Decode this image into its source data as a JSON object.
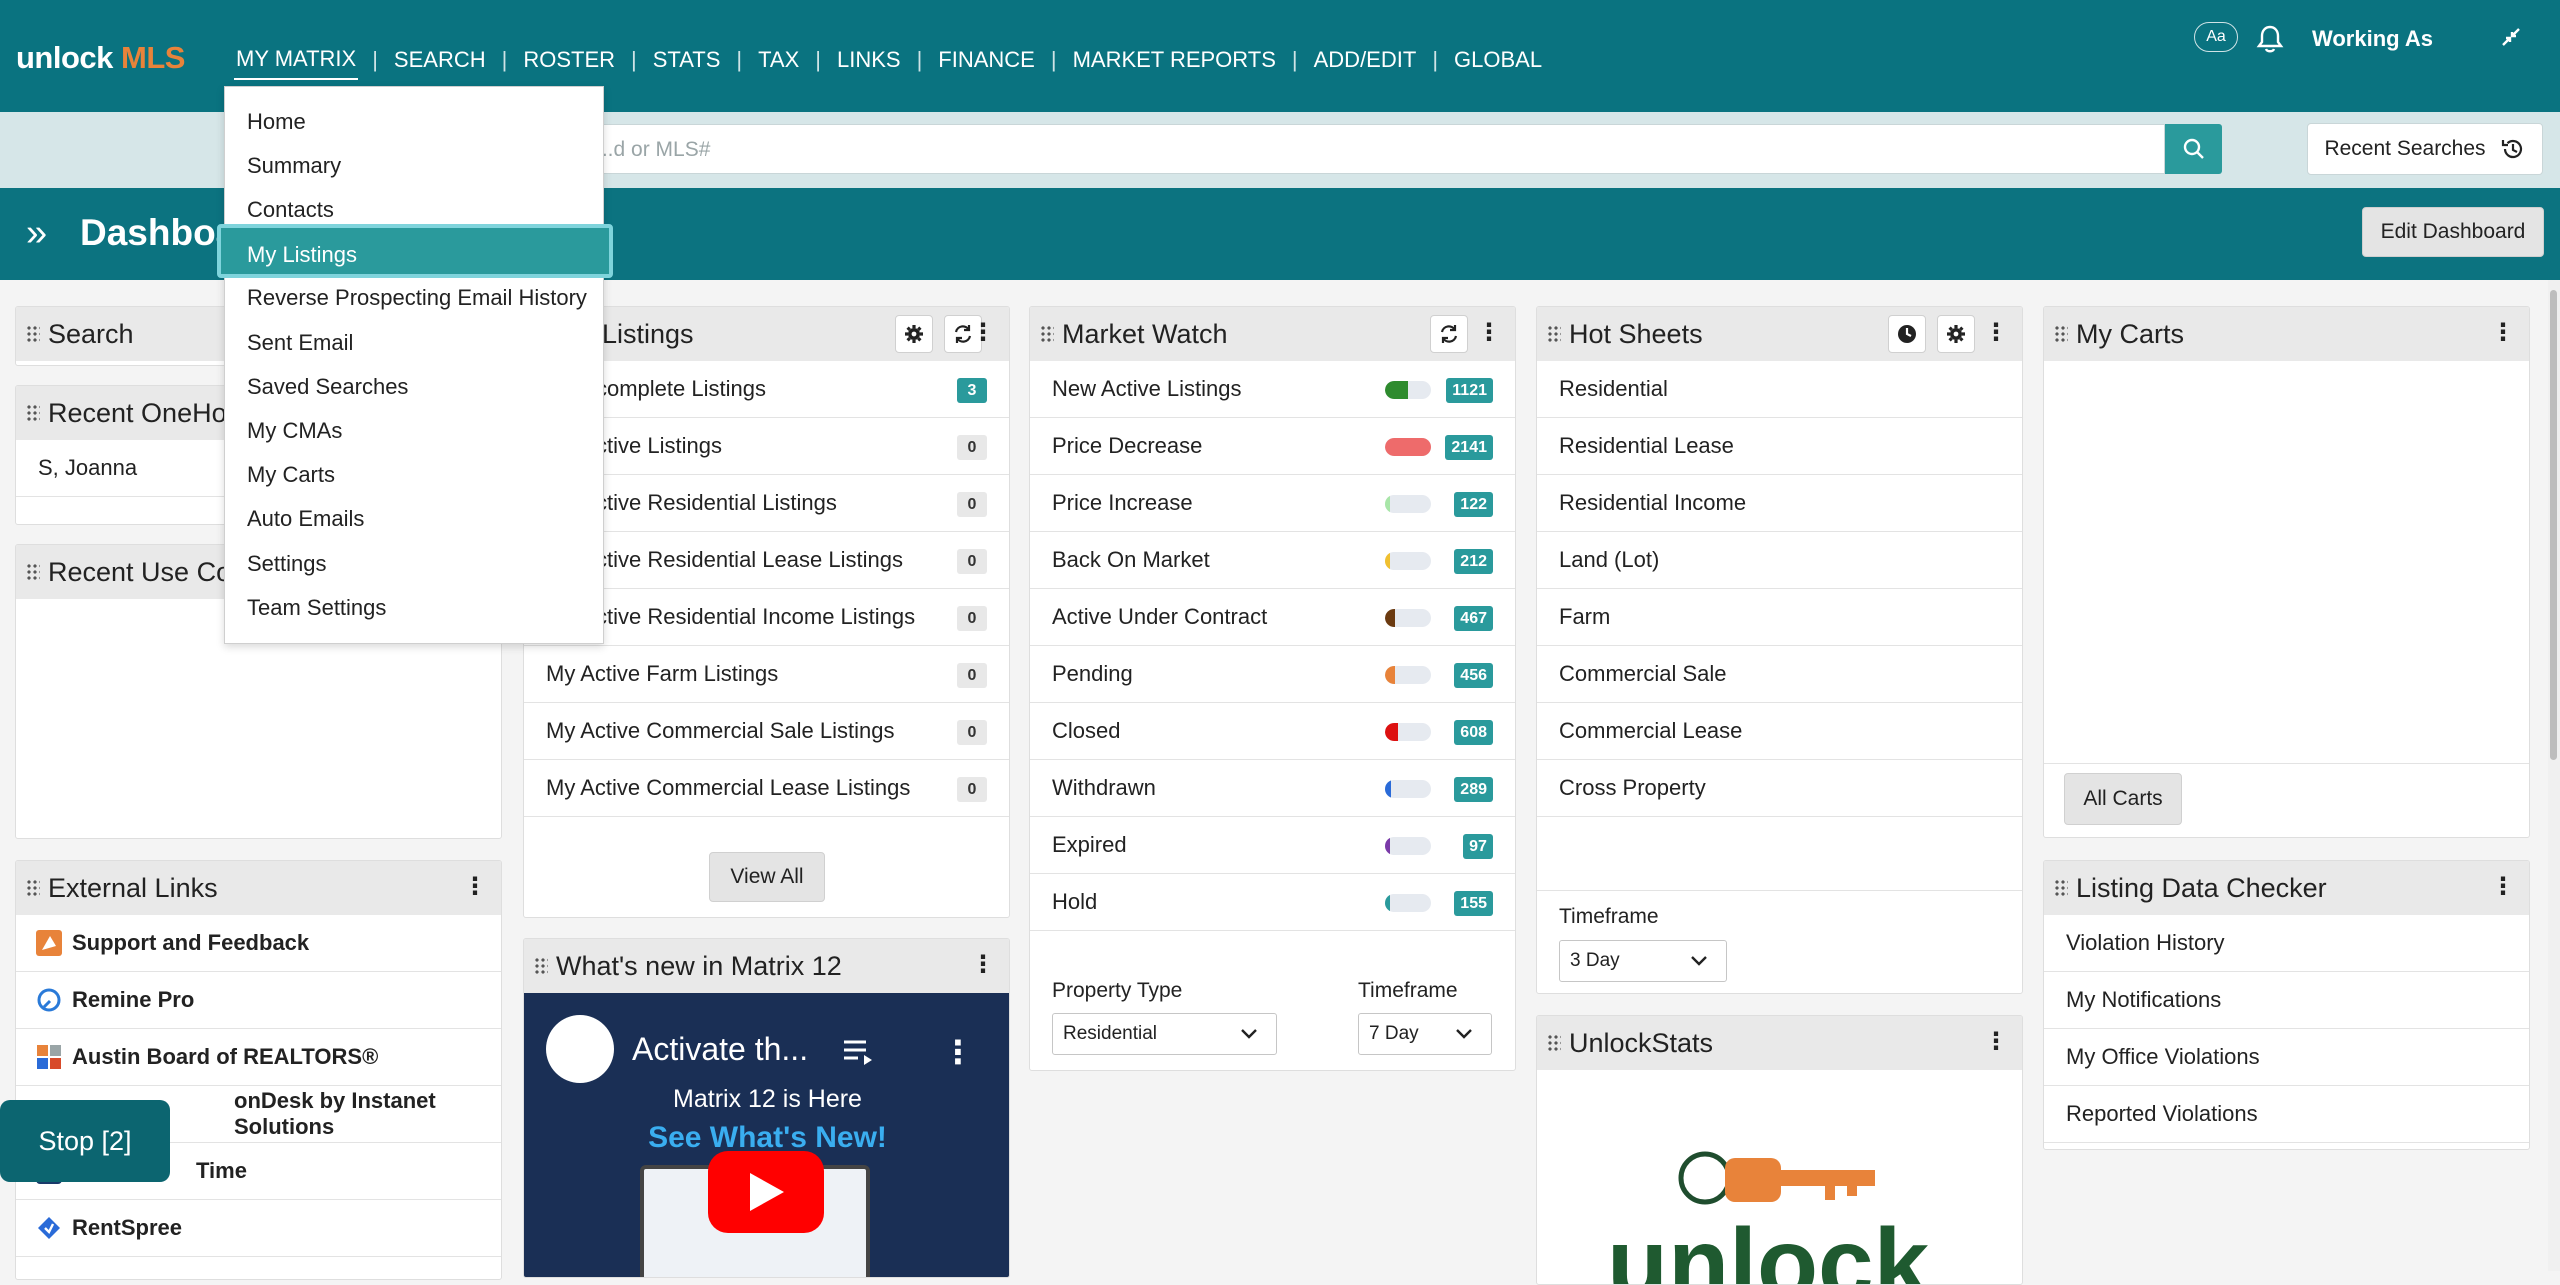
{
  "app": {
    "logo_prefix": "unlock",
    "logo_suffix": " MLS"
  },
  "menu": [
    "MY MATRIX",
    "SEARCH",
    "ROSTER",
    "STATS",
    "TAX",
    "LINKS",
    "FINANCE",
    "MARKET REPORTS",
    "ADD/EDIT",
    "GLOBAL"
  ],
  "header": {
    "font_toggle": "Aa",
    "working_as": "Working As"
  },
  "search": {
    "placeholder": "...d or MLS#",
    "recent_searches": "Recent Searches"
  },
  "dashboard": {
    "title": "Dashboa",
    "edit_button": "Edit Dashboard"
  },
  "dropdown": {
    "items": [
      "Home",
      "Summary",
      "Contacts",
      "My Listings",
      "Reverse Prospecting Email History",
      "Sent Email",
      "Saved Searches",
      "My CMAs",
      "My Carts",
      "Auto Emails",
      "Settings",
      "Team Settings"
    ],
    "highlighted": "My Listings"
  },
  "panels": {
    "search": {
      "title": "Search"
    },
    "recent_onehome": {
      "title": "Recent OneHo",
      "rows": [
        "S, Joanna"
      ]
    },
    "recent_use": {
      "title": "Recent Use Co"
    },
    "my_listings": {
      "title": "Listings",
      "rows": [
        {
          "label": "complete Listings",
          "count": "3",
          "style": "t"
        },
        {
          "label": "ctive Listings",
          "count": "0",
          "style": "g"
        },
        {
          "label": "ctive Residential Listings",
          "count": "0",
          "style": "g"
        },
        {
          "label": "ctive Residential Lease Listings",
          "count": "0",
          "style": "g"
        },
        {
          "label": "ctive Residential Income Listings",
          "count": "0",
          "style": "g"
        },
        {
          "label": "My Active Farm Listings",
          "count": "0",
          "style": "g"
        },
        {
          "label": "My Active Commercial Sale Listings",
          "count": "0",
          "style": "g"
        },
        {
          "label": "My Active Commercial Lease Listings",
          "count": "0",
          "style": "g"
        }
      ],
      "view_all": "View All"
    },
    "whats_new": {
      "title": "What's new in Matrix 12",
      "video_title": "Activate th...",
      "video_line1": "Matrix 12 is Here",
      "video_line2": "See What's New!"
    },
    "market_watch": {
      "title": "Market Watch",
      "rows": [
        {
          "label": "New Active Listings",
          "count": "1121",
          "color": "#2e8b2e",
          "level": 0.5
        },
        {
          "label": "Price Decrease",
          "count": "2141",
          "color": "#ee6b6b",
          "level": 1.0
        },
        {
          "label": "Price Increase",
          "count": "122",
          "color": "#a8e6a8",
          "level": 0.06
        },
        {
          "label": "Back On Market",
          "count": "212",
          "color": "#f0c030",
          "level": 0.1
        },
        {
          "label": "Active Under Contract",
          "count": "467",
          "color": "#6b3a10",
          "level": 0.22
        },
        {
          "label": "Pending",
          "count": "456",
          "color": "#e8833a",
          "level": 0.21
        },
        {
          "label": "Closed",
          "count": "608",
          "color": "#dd1111",
          "level": 0.28
        },
        {
          "label": "Withdrawn",
          "count": "289",
          "color": "#2a6bd8",
          "level": 0.13
        },
        {
          "label": "Expired",
          "count": "97",
          "color": "#7a3aa8",
          "level": 0.05
        },
        {
          "label": "Hold",
          "count": "155",
          "color": "#2a9a9c",
          "level": 0.07
        }
      ],
      "property_type_label": "Property Type",
      "property_type_value": "Residential",
      "timeframe_label": "Timeframe",
      "timeframe_value": "7 Day"
    },
    "hot_sheets": {
      "title": "Hot Sheets",
      "rows": [
        "Residential",
        "Residential Lease",
        "Residential Income",
        "Land (Lot)",
        "Farm",
        "Commercial Sale",
        "Commercial Lease",
        "Cross Property"
      ],
      "timeframe_label": "Timeframe",
      "timeframe_value": "3 Day"
    },
    "unlockstats": {
      "title": "UnlockStats",
      "logo_text": "unlock"
    },
    "my_carts": {
      "title": "My Carts",
      "all_carts": "All Carts"
    },
    "listing_data_checker": {
      "title": "Listing Data Checker",
      "rows": [
        "Violation History",
        "My Notifications",
        "My Office Violations",
        "Reported Violations"
      ]
    },
    "external_links": {
      "title": "External Links",
      "rows": [
        {
          "label": "Support and Feedback",
          "icon": "support-icon"
        },
        {
          "label": "Remine Pro",
          "icon": "remine-icon"
        },
        {
          "label": "Austin Board of REALTORS®",
          "icon": "abor-icon"
        },
        {
          "label": "onDesk by Instanet Solutions",
          "icon": "instanet-icon"
        },
        {
          "label": "Time",
          "icon": "showingtime-icon"
        },
        {
          "label": "RentSpree",
          "icon": "rentspree-icon"
        }
      ]
    }
  },
  "stop_button": "Stop [2]",
  "colors": {
    "primary": "#0a7380",
    "accent": "#2a9a9c",
    "logo_accent": "#e8833a"
  }
}
